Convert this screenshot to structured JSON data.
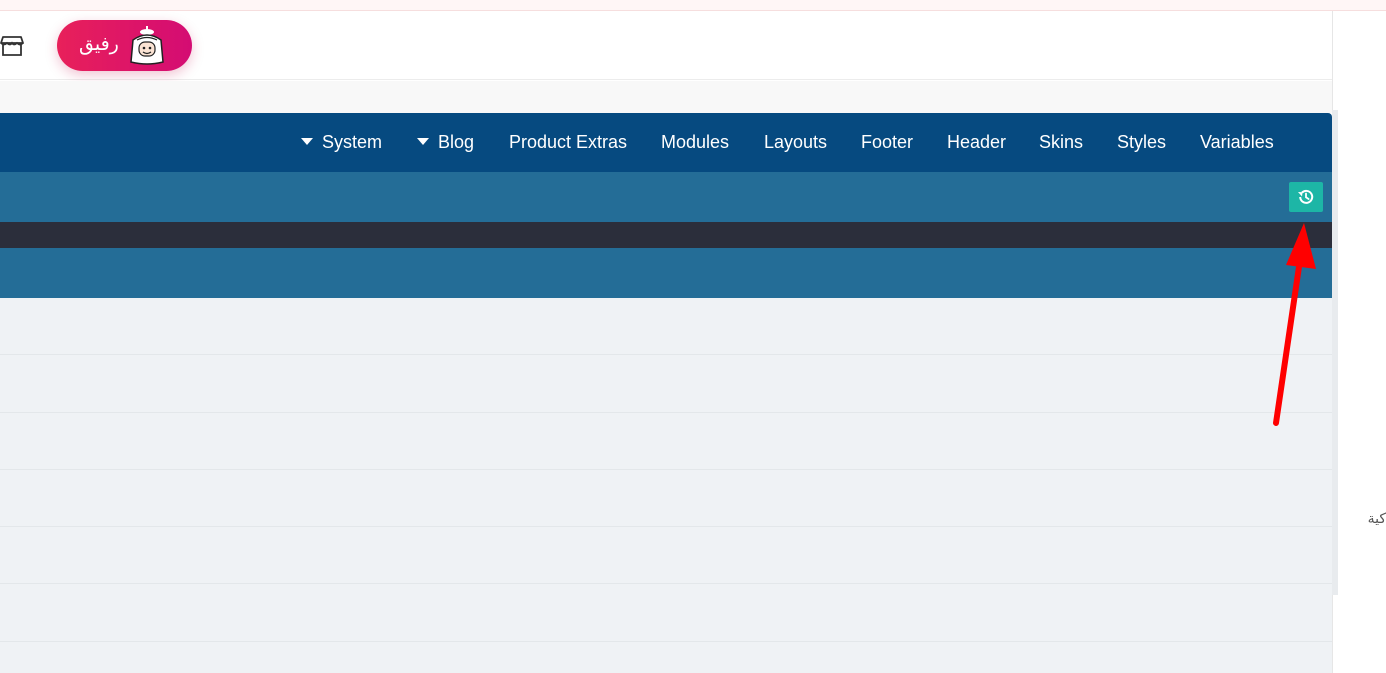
{
  "top_bar": {
    "store_icon": "store-icon",
    "rafiq_button": {
      "label": "رفيق",
      "mascot_icon": "rafiq-mascot-icon"
    }
  },
  "nav": {
    "items": [
      {
        "label": "System",
        "has_dropdown": true
      },
      {
        "label": "Blog",
        "has_dropdown": true
      },
      {
        "label": "Product Extras",
        "has_dropdown": false
      },
      {
        "label": "Modules",
        "has_dropdown": false
      },
      {
        "label": "Layouts",
        "has_dropdown": false
      },
      {
        "label": "Footer",
        "has_dropdown": false
      },
      {
        "label": "Header",
        "has_dropdown": false
      },
      {
        "label": "Skins",
        "has_dropdown": false
      },
      {
        "label": "Styles",
        "has_dropdown": false
      },
      {
        "label": "Variables",
        "has_dropdown": false
      }
    ]
  },
  "toolbar": {
    "history_icon": "history-icon"
  },
  "side_panel": {
    "text": "كية"
  },
  "annotation": {
    "arrow_color": "#ff0000",
    "points_to": "history-button"
  },
  "colors": {
    "nav_bg": "#064a80",
    "toolbar_bg": "#246d97",
    "dark_strip": "#2b2e3b",
    "history_btn": "#1db6a6",
    "rafiq_gradient_start": "#e8205a",
    "rafiq_gradient_end": "#d40c73",
    "content_bg": "#eff2f5"
  }
}
